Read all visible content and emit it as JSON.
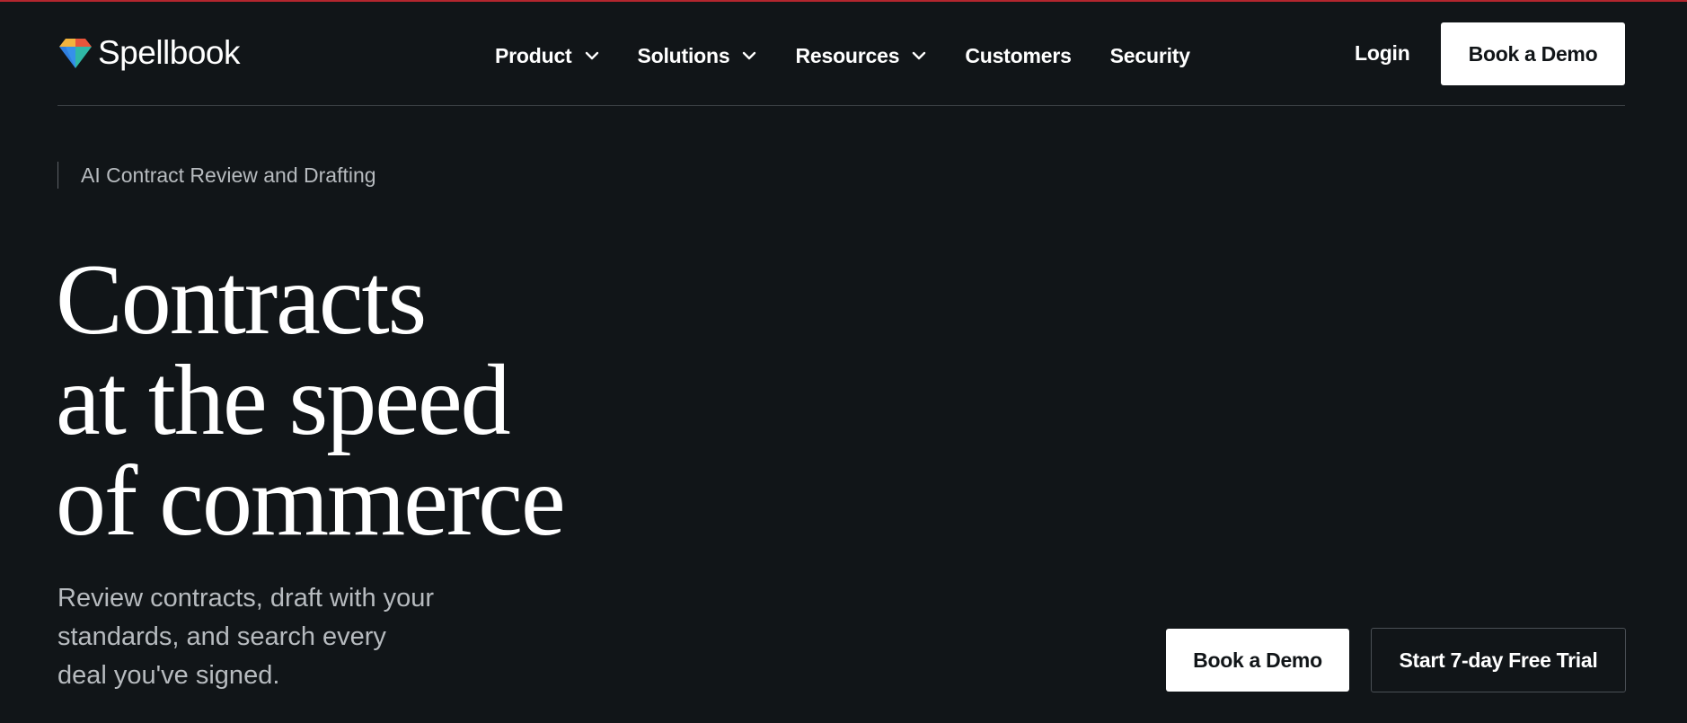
{
  "brand": {
    "name": "Spellbook",
    "icon": "gem-icon",
    "colors": {
      "background": "#111518",
      "accent_top": "#b3262e",
      "button_bg": "#ffffff",
      "text_muted": "#b7bbbf"
    }
  },
  "nav": {
    "items": [
      {
        "label": "Product",
        "has_dropdown": true
      },
      {
        "label": "Solutions",
        "has_dropdown": true
      },
      {
        "label": "Resources",
        "has_dropdown": true
      },
      {
        "label": "Customers",
        "has_dropdown": false
      },
      {
        "label": "Security",
        "has_dropdown": false
      }
    ],
    "login_label": "Login",
    "demo_label": "Book a Demo"
  },
  "hero": {
    "eyebrow": "AI Contract Review and Drafting",
    "headline_lines": [
      "Contracts",
      "at the speed",
      "of commerce"
    ],
    "subhead": "Review contracts, draft with your standards, and search every deal you've signed.",
    "cta_primary": "Book a Demo",
    "cta_secondary": "Start 7-day Free Trial"
  }
}
